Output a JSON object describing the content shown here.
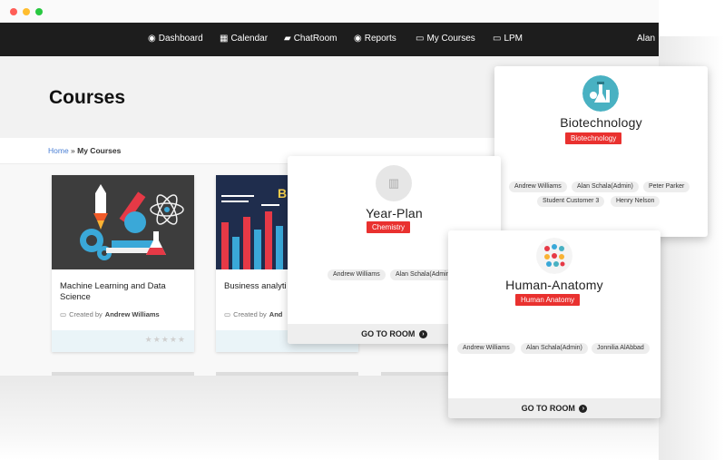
{
  "nav": {
    "items": [
      {
        "icon": "palette-icon",
        "label": "Dashboard"
      },
      {
        "icon": "calendar-icon",
        "label": "Calendar"
      },
      {
        "icon": "chat-icon",
        "label": "ChatRoom"
      },
      {
        "icon": "palette-icon",
        "label": "Reports"
      },
      {
        "icon": "monitor-icon",
        "label": "My Courses"
      },
      {
        "icon": "monitor-icon",
        "label": "LPM"
      }
    ],
    "user": "Alan"
  },
  "page_title": "Courses",
  "breadcrumb": {
    "home": "Home",
    "separator": " » ",
    "current": "My Courses"
  },
  "courses": [
    {
      "title": "Machine Learning and Data Science",
      "created_by_prefix": "Created by",
      "author": "Andrew Williams",
      "stars": "★★★★★"
    },
    {
      "title": "Business analyti",
      "created_by_prefix": "Created by",
      "author": "And",
      "image_text": "B"
    }
  ],
  "rooms": {
    "biotechnology": {
      "name": "Biotechnology",
      "badge": "Biotechnology",
      "members": [
        "Andrew Williams",
        "Alan Schala(Admin)",
        "Peter Parker",
        "Student Customer 3",
        "Henry Nelson"
      ]
    },
    "year_plan": {
      "name": "Year-Plan",
      "badge": "Chemistry",
      "members": [
        "Andrew Williams",
        "Alan Schala(Admin"
      ],
      "button": "GO TO ROOM"
    },
    "human_anatomy": {
      "name": "Human-Anatomy",
      "badge": "Human Anatomy",
      "members": [
        "Andrew Williams",
        "Alan Schala(Admin)",
        "Jonnilia AlAbbad"
      ],
      "button": "GO TO ROOM"
    }
  },
  "colors": {
    "navbar": "#1d1d1d",
    "badge": "#e9312f",
    "link": "#4a7fd4"
  }
}
